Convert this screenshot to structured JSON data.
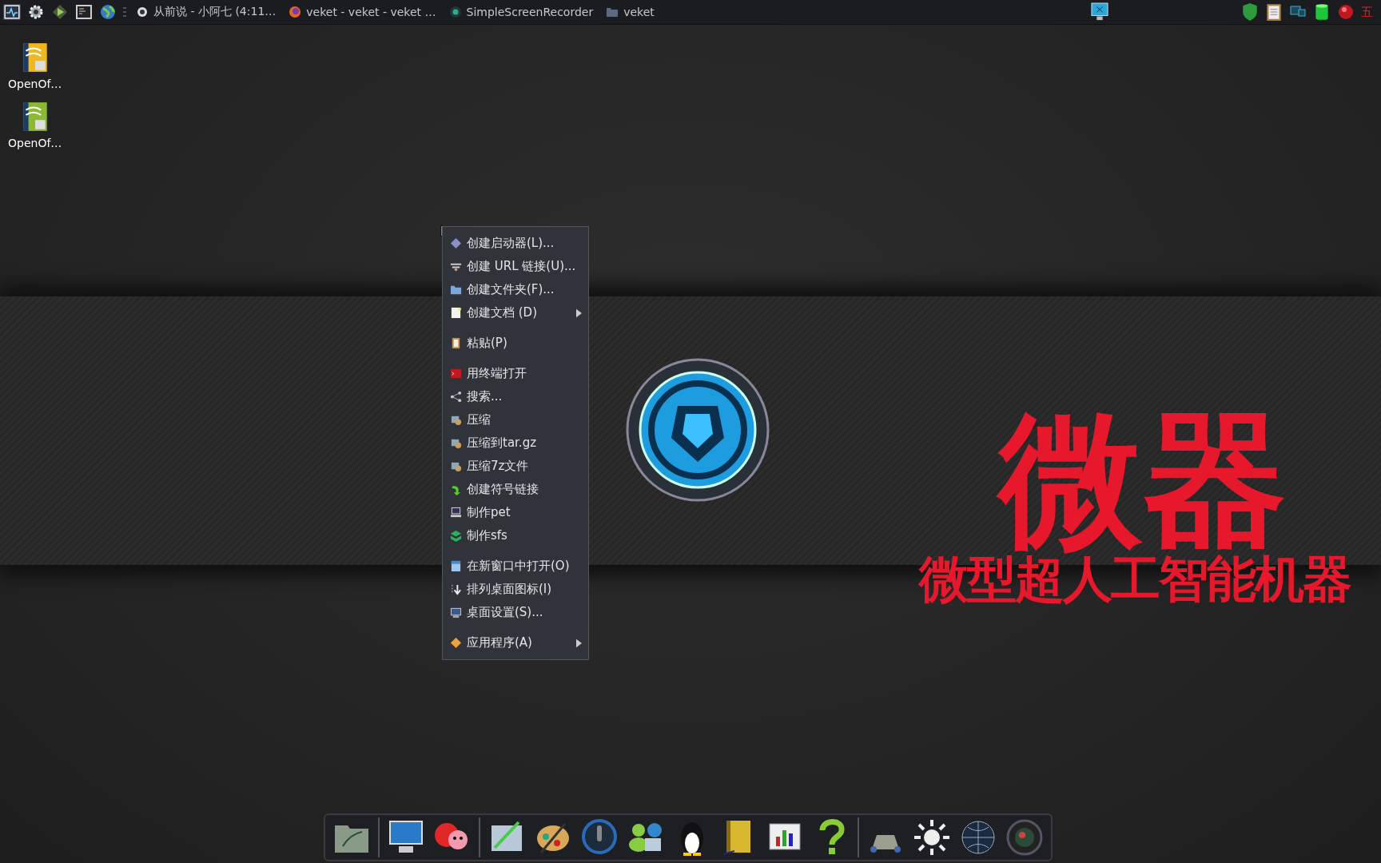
{
  "taskbar": {
    "tasks": [
      {
        "label": "从前说 - 小阿七 (4:11…",
        "kind": "music"
      },
      {
        "label": "veket - veket - veket …",
        "kind": "browser"
      },
      {
        "label": "SimpleScreenRecorder",
        "kind": "recorder"
      },
      {
        "label": "veket",
        "kind": "folder"
      }
    ],
    "input_method": "五"
  },
  "desktop_icons": [
    {
      "label": "OpenOf…",
      "kind": "writer"
    },
    {
      "label": "OpenOf…",
      "kind": "calc"
    }
  ],
  "context_menu": {
    "items": [
      {
        "kind": "item",
        "label": "创建启动器(L)...",
        "submenu": false
      },
      {
        "kind": "item",
        "label": "创建 URL 链接(U)...",
        "submenu": false
      },
      {
        "kind": "item",
        "label": "创建文件夹(F)...",
        "submenu": false
      },
      {
        "kind": "item",
        "label": "创建文档 (D)",
        "submenu": true
      },
      {
        "kind": "separator"
      },
      {
        "kind": "item",
        "label": "粘贴(P)",
        "submenu": false
      },
      {
        "kind": "separator"
      },
      {
        "kind": "item",
        "label": "用终端打开",
        "submenu": false
      },
      {
        "kind": "item",
        "label": "搜索...",
        "submenu": false
      },
      {
        "kind": "item",
        "label": "压缩",
        "submenu": false
      },
      {
        "kind": "item",
        "label": "压缩到tar.gz",
        "submenu": false
      },
      {
        "kind": "item",
        "label": "压缩7z文件",
        "submenu": false
      },
      {
        "kind": "item",
        "label": "创建符号链接",
        "submenu": false
      },
      {
        "kind": "item",
        "label": "制作pet",
        "submenu": false
      },
      {
        "kind": "item",
        "label": "制作sfs",
        "submenu": false
      },
      {
        "kind": "separator"
      },
      {
        "kind": "item",
        "label": "在新窗口中打开(O)",
        "submenu": false
      },
      {
        "kind": "item",
        "label": "排列桌面图标(I)",
        "submenu": false
      },
      {
        "kind": "item",
        "label": "桌面设置(S)...",
        "submenu": false
      },
      {
        "kind": "separator"
      },
      {
        "kind": "item",
        "label": "应用程序(A)",
        "submenu": true
      }
    ]
  },
  "wallpaper": {
    "headline": "微器",
    "tagline": "微型超人工智能机器"
  }
}
